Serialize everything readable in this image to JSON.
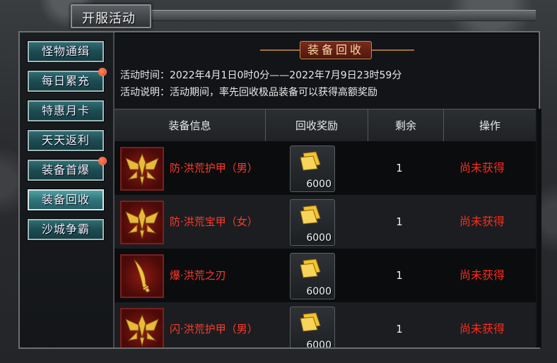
{
  "window": {
    "title": "开服活动"
  },
  "sidebar": {
    "items": [
      {
        "label": "怪物通缉",
        "badge": false,
        "active": false
      },
      {
        "label": "每日累充",
        "badge": true,
        "active": false
      },
      {
        "label": "特惠月卡",
        "badge": false,
        "active": false
      },
      {
        "label": "天天返利",
        "badge": false,
        "active": false
      },
      {
        "label": "装备首爆",
        "badge": true,
        "active": false
      },
      {
        "label": "装备回收",
        "badge": false,
        "active": true
      },
      {
        "label": "沙城争霸",
        "badge": false,
        "active": false
      }
    ]
  },
  "main": {
    "banner_title": "装备回收",
    "activity_time": "活动时间：2022年4月1日0时0分——2022年7月9日23时59分",
    "activity_desc": "活动说明：活动期间，率先回收极品装备可以获得高额奖励",
    "table": {
      "headers": [
        "装备信息",
        "回收奖励",
        "剩余",
        "操作"
      ],
      "rows": [
        {
          "name": "防·洪荒护甲（男）",
          "icon": "armor-icon",
          "reward_qty": "6000",
          "remain": "1",
          "status": "尚未获得"
        },
        {
          "name": "防·洪荒宝甲（女）",
          "icon": "armor-icon",
          "reward_qty": "6000",
          "remain": "1",
          "status": "尚未获得"
        },
        {
          "name": "爆·洪荒之刃",
          "icon": "blade-icon",
          "reward_qty": "6000",
          "remain": "1",
          "status": "尚未获得"
        },
        {
          "name": "闪·洪荒护甲（男）",
          "icon": "armor-icon",
          "reward_qty": "6000",
          "remain": "1",
          "status": "尚未获得"
        }
      ]
    }
  },
  "colors": {
    "status_red": "#ff2a1a",
    "item_name_red": "#ff3a2a",
    "button_teal": "#2f6d72",
    "gold": "#f2c230"
  }
}
